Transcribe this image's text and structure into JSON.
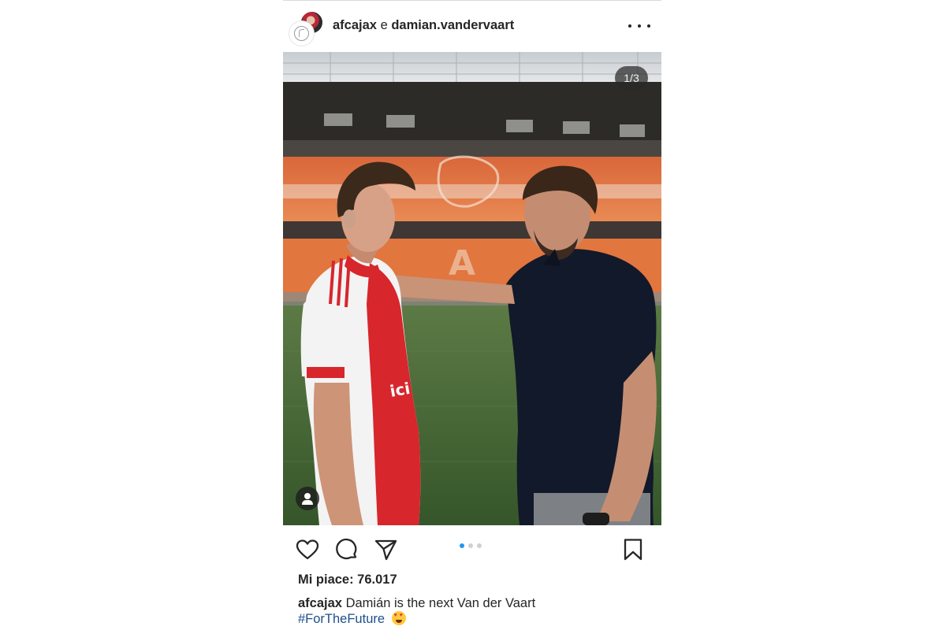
{
  "post": {
    "header": {
      "user1": "afcajax",
      "conjunction": "e",
      "user2": "damian.vandervaart",
      "more_icon": "more-horizontal-icon"
    },
    "photo": {
      "counter": "1/3",
      "tag_icon": "tagged-people-icon",
      "stadium_colors": {
        "seats": "#e0733a",
        "pitch": "#3f6b2f",
        "roof": "#2c2b28"
      }
    },
    "actions": {
      "icons": [
        "heart-icon",
        "comment-icon",
        "share-icon",
        "bookmark-icon"
      ],
      "carousel_dots": 3,
      "active_dot": 0,
      "accent_color": "#1f96f3"
    },
    "likes": "Mi piace: 76.017",
    "caption": {
      "user": "afcajax",
      "text": "Damián is the next Van der Vaart",
      "hashtag": "#ForTheFuture"
    }
  }
}
